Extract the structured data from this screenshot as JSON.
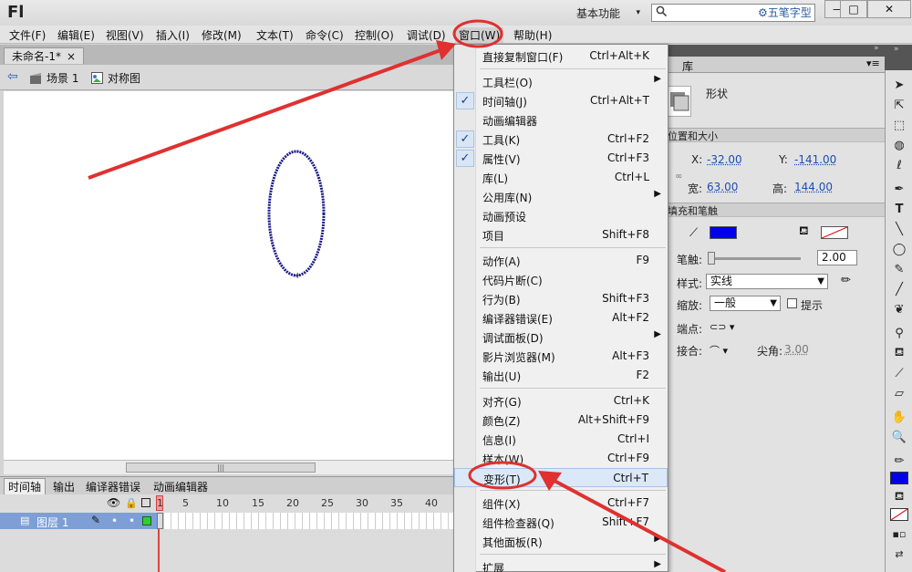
{
  "app": {
    "logo": "Fl",
    "workspace": "基本功能",
    "watermark": "五笔字型"
  },
  "window_buttons": [
    "—",
    "□",
    "✕"
  ],
  "menubar": [
    "文件(F)",
    "编辑(E)",
    "视图(V)",
    "插入(I)",
    "修改(M)",
    "文本(T)",
    "命令(C)",
    "控制(O)",
    "调试(D)",
    "窗口(W)",
    "帮助(H)"
  ],
  "document": {
    "tab": "未命名-1*",
    "tab_close": "×",
    "breadcrumb": {
      "scene": "场景 1",
      "symbol": "对称图"
    }
  },
  "timeline": {
    "tabs": [
      "时间轴",
      "输出",
      "编译器错误",
      "动画编辑器"
    ],
    "frame_numbers": [
      "1",
      "5",
      "10",
      "15",
      "20",
      "25",
      "30",
      "35",
      "40"
    ],
    "layer_name": "图层 1"
  },
  "properties": {
    "tabs": [
      "库"
    ],
    "type_label": "形状",
    "sections": {
      "position_size": "位置和大小",
      "fill_stroke": "填充和笔触"
    },
    "x_label": "X:",
    "x_value": "-32.00",
    "y_label": "Y:",
    "y_value": "-141.00",
    "w_label": "宽:",
    "w_value": "63.00",
    "h_label": "高:",
    "h_value": "144.00",
    "stroke_label": "笔触:",
    "stroke_value": "2.00",
    "style_label": "样式:",
    "style_value": "实线",
    "scale_label": "缩放:",
    "scale_value": "一般",
    "hint_label": "提示",
    "cap_label": "端点:",
    "join_label": "接合:",
    "miter_label": "尖角:",
    "miter_value": "3.00",
    "stroke_color": "#0000ee",
    "toolbar_fill_color": "#0000ee"
  },
  "menu": {
    "items": [
      {
        "label": "直接复制窗口(F)",
        "shortcut": "Ctrl+Alt+K",
        "checked": false,
        "submenu": false
      },
      {
        "separator": true
      },
      {
        "label": "工具栏(O)",
        "shortcut": "",
        "checked": false,
        "submenu": true
      },
      {
        "label": "时间轴(J)",
        "shortcut": "Ctrl+Alt+T",
        "checked": true,
        "submenu": false
      },
      {
        "label": "动画编辑器",
        "shortcut": "",
        "checked": false,
        "submenu": false
      },
      {
        "label": "工具(K)",
        "shortcut": "Ctrl+F2",
        "checked": true,
        "submenu": false
      },
      {
        "label": "属性(V)",
        "shortcut": "Ctrl+F3",
        "checked": true,
        "submenu": false
      },
      {
        "label": "库(L)",
        "shortcut": "Ctrl+L",
        "checked": false,
        "submenu": false
      },
      {
        "label": "公用库(N)",
        "shortcut": "",
        "checked": false,
        "submenu": true
      },
      {
        "label": "动画预设",
        "shortcut": "",
        "checked": false,
        "submenu": false
      },
      {
        "label": "项目",
        "shortcut": "Shift+F8",
        "checked": false,
        "submenu": false
      },
      {
        "separator": true
      },
      {
        "label": "动作(A)",
        "shortcut": "F9",
        "checked": false,
        "submenu": false
      },
      {
        "label": "代码片断(C)",
        "shortcut": "",
        "checked": false,
        "submenu": false
      },
      {
        "label": "行为(B)",
        "shortcut": "Shift+F3",
        "checked": false,
        "submenu": false
      },
      {
        "label": "编译器错误(E)",
        "shortcut": "Alt+F2",
        "checked": false,
        "submenu": false
      },
      {
        "label": "调试面板(D)",
        "shortcut": "",
        "checked": false,
        "submenu": true
      },
      {
        "label": "影片浏览器(M)",
        "shortcut": "Alt+F3",
        "checked": false,
        "submenu": false
      },
      {
        "label": "输出(U)",
        "shortcut": "F2",
        "checked": false,
        "submenu": false
      },
      {
        "separator": true
      },
      {
        "label": "对齐(G)",
        "shortcut": "Ctrl+K",
        "checked": false,
        "submenu": false
      },
      {
        "label": "颜色(Z)",
        "shortcut": "Alt+Shift+F9",
        "checked": false,
        "submenu": false
      },
      {
        "label": "信息(I)",
        "shortcut": "Ctrl+I",
        "checked": false,
        "submenu": false
      },
      {
        "label": "样本(W)",
        "shortcut": "Ctrl+F9",
        "checked": false,
        "submenu": false
      },
      {
        "label": "变形(T)",
        "shortcut": "Ctrl+T",
        "checked": false,
        "submenu": false,
        "highlighted": true
      },
      {
        "separator": true
      },
      {
        "label": "组件(X)",
        "shortcut": "Ctrl+F7",
        "checked": false,
        "submenu": false
      },
      {
        "label": "组件检查器(Q)",
        "shortcut": "Shift+F7",
        "checked": false,
        "submenu": false
      },
      {
        "label": "其他面板(R)",
        "shortcut": "",
        "checked": false,
        "submenu": true
      },
      {
        "separator": true
      },
      {
        "label": "扩展",
        "shortcut": "",
        "checked": false,
        "submenu": true
      }
    ]
  },
  "tools": [
    "selection-tool",
    "subselection-tool",
    "free-transform-tool",
    "3d-rotation-tool",
    "lasso-tool",
    "pen-tool",
    "text-tool",
    "line-tool",
    "oval-tool",
    "pencil-tool",
    "brush-tool",
    "deco-tool",
    "bone-tool",
    "paint-bucket-tool",
    "eyedropper-tool",
    "eraser-tool",
    "hand-tool",
    "zoom-tool",
    "stroke-color",
    "fill-color",
    "swap-colors"
  ],
  "colors": {
    "annotation": "#e03030",
    "ellipse_stroke": "#1a1a8c",
    "menu_highlight": "#dbe8f7"
  }
}
